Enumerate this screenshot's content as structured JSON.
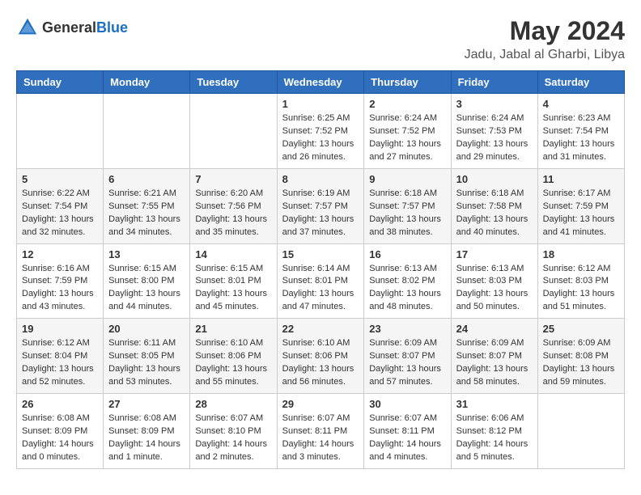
{
  "logo": {
    "general": "General",
    "blue": "Blue"
  },
  "title": "May 2024",
  "location": "Jadu, Jabal al Gharbi, Libya",
  "weekdays": [
    "Sunday",
    "Monday",
    "Tuesday",
    "Wednesday",
    "Thursday",
    "Friday",
    "Saturday"
  ],
  "weeks": [
    [
      {
        "day": "",
        "info": ""
      },
      {
        "day": "",
        "info": ""
      },
      {
        "day": "",
        "info": ""
      },
      {
        "day": "1",
        "info": "Sunrise: 6:25 AM\nSunset: 7:52 PM\nDaylight: 13 hours and 26 minutes."
      },
      {
        "day": "2",
        "info": "Sunrise: 6:24 AM\nSunset: 7:52 PM\nDaylight: 13 hours and 27 minutes."
      },
      {
        "day": "3",
        "info": "Sunrise: 6:24 AM\nSunset: 7:53 PM\nDaylight: 13 hours and 29 minutes."
      },
      {
        "day": "4",
        "info": "Sunrise: 6:23 AM\nSunset: 7:54 PM\nDaylight: 13 hours and 31 minutes."
      }
    ],
    [
      {
        "day": "5",
        "info": "Sunrise: 6:22 AM\nSunset: 7:54 PM\nDaylight: 13 hours and 32 minutes."
      },
      {
        "day": "6",
        "info": "Sunrise: 6:21 AM\nSunset: 7:55 PM\nDaylight: 13 hours and 34 minutes."
      },
      {
        "day": "7",
        "info": "Sunrise: 6:20 AM\nSunset: 7:56 PM\nDaylight: 13 hours and 35 minutes."
      },
      {
        "day": "8",
        "info": "Sunrise: 6:19 AM\nSunset: 7:57 PM\nDaylight: 13 hours and 37 minutes."
      },
      {
        "day": "9",
        "info": "Sunrise: 6:18 AM\nSunset: 7:57 PM\nDaylight: 13 hours and 38 minutes."
      },
      {
        "day": "10",
        "info": "Sunrise: 6:18 AM\nSunset: 7:58 PM\nDaylight: 13 hours and 40 minutes."
      },
      {
        "day": "11",
        "info": "Sunrise: 6:17 AM\nSunset: 7:59 PM\nDaylight: 13 hours and 41 minutes."
      }
    ],
    [
      {
        "day": "12",
        "info": "Sunrise: 6:16 AM\nSunset: 7:59 PM\nDaylight: 13 hours and 43 minutes."
      },
      {
        "day": "13",
        "info": "Sunrise: 6:15 AM\nSunset: 8:00 PM\nDaylight: 13 hours and 44 minutes."
      },
      {
        "day": "14",
        "info": "Sunrise: 6:15 AM\nSunset: 8:01 PM\nDaylight: 13 hours and 45 minutes."
      },
      {
        "day": "15",
        "info": "Sunrise: 6:14 AM\nSunset: 8:01 PM\nDaylight: 13 hours and 47 minutes."
      },
      {
        "day": "16",
        "info": "Sunrise: 6:13 AM\nSunset: 8:02 PM\nDaylight: 13 hours and 48 minutes."
      },
      {
        "day": "17",
        "info": "Sunrise: 6:13 AM\nSunset: 8:03 PM\nDaylight: 13 hours and 50 minutes."
      },
      {
        "day": "18",
        "info": "Sunrise: 6:12 AM\nSunset: 8:03 PM\nDaylight: 13 hours and 51 minutes."
      }
    ],
    [
      {
        "day": "19",
        "info": "Sunrise: 6:12 AM\nSunset: 8:04 PM\nDaylight: 13 hours and 52 minutes."
      },
      {
        "day": "20",
        "info": "Sunrise: 6:11 AM\nSunset: 8:05 PM\nDaylight: 13 hours and 53 minutes."
      },
      {
        "day": "21",
        "info": "Sunrise: 6:10 AM\nSunset: 8:06 PM\nDaylight: 13 hours and 55 minutes."
      },
      {
        "day": "22",
        "info": "Sunrise: 6:10 AM\nSunset: 8:06 PM\nDaylight: 13 hours and 56 minutes."
      },
      {
        "day": "23",
        "info": "Sunrise: 6:09 AM\nSunset: 8:07 PM\nDaylight: 13 hours and 57 minutes."
      },
      {
        "day": "24",
        "info": "Sunrise: 6:09 AM\nSunset: 8:07 PM\nDaylight: 13 hours and 58 minutes."
      },
      {
        "day": "25",
        "info": "Sunrise: 6:09 AM\nSunset: 8:08 PM\nDaylight: 13 hours and 59 minutes."
      }
    ],
    [
      {
        "day": "26",
        "info": "Sunrise: 6:08 AM\nSunset: 8:09 PM\nDaylight: 14 hours and 0 minutes."
      },
      {
        "day": "27",
        "info": "Sunrise: 6:08 AM\nSunset: 8:09 PM\nDaylight: 14 hours and 1 minute."
      },
      {
        "day": "28",
        "info": "Sunrise: 6:07 AM\nSunset: 8:10 PM\nDaylight: 14 hours and 2 minutes."
      },
      {
        "day": "29",
        "info": "Sunrise: 6:07 AM\nSunset: 8:11 PM\nDaylight: 14 hours and 3 minutes."
      },
      {
        "day": "30",
        "info": "Sunrise: 6:07 AM\nSunset: 8:11 PM\nDaylight: 14 hours and 4 minutes."
      },
      {
        "day": "31",
        "info": "Sunrise: 6:06 AM\nSunset: 8:12 PM\nDaylight: 14 hours and 5 minutes."
      },
      {
        "day": "",
        "info": ""
      }
    ]
  ]
}
